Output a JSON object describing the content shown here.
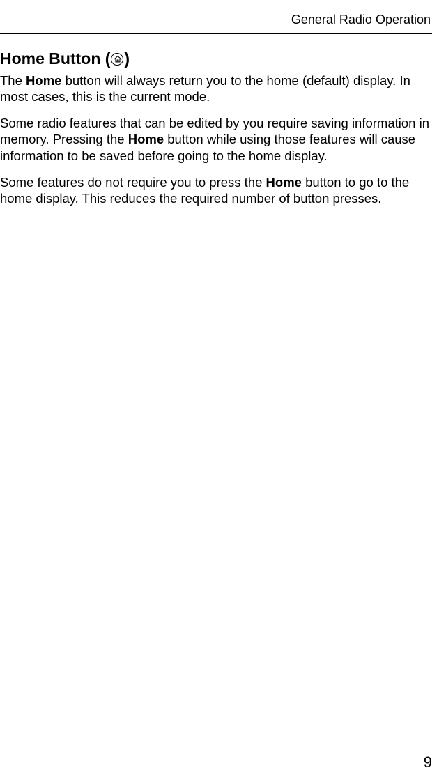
{
  "header": {
    "running_title": "General Radio Operation"
  },
  "section": {
    "title_prefix": "Home Button (",
    "title_suffix": ")",
    "icon_name": "home-icon"
  },
  "paragraphs": {
    "p1_a": "The ",
    "p1_b": "Home",
    "p1_c": " button will always return you to the home (default) display. In most cases, this is the current mode.",
    "p2_a": "Some radio features that can be edited by you require saving information in memory. Pressing the ",
    "p2_b": "Home",
    "p2_c": " button while using those features will cause information to be saved before going to the home display.",
    "p3_a": "Some features do not require you to press the ",
    "p3_b": "Home",
    "p3_c": " button to go to the home display. This reduces the required number of button presses."
  },
  "page_number": "9"
}
